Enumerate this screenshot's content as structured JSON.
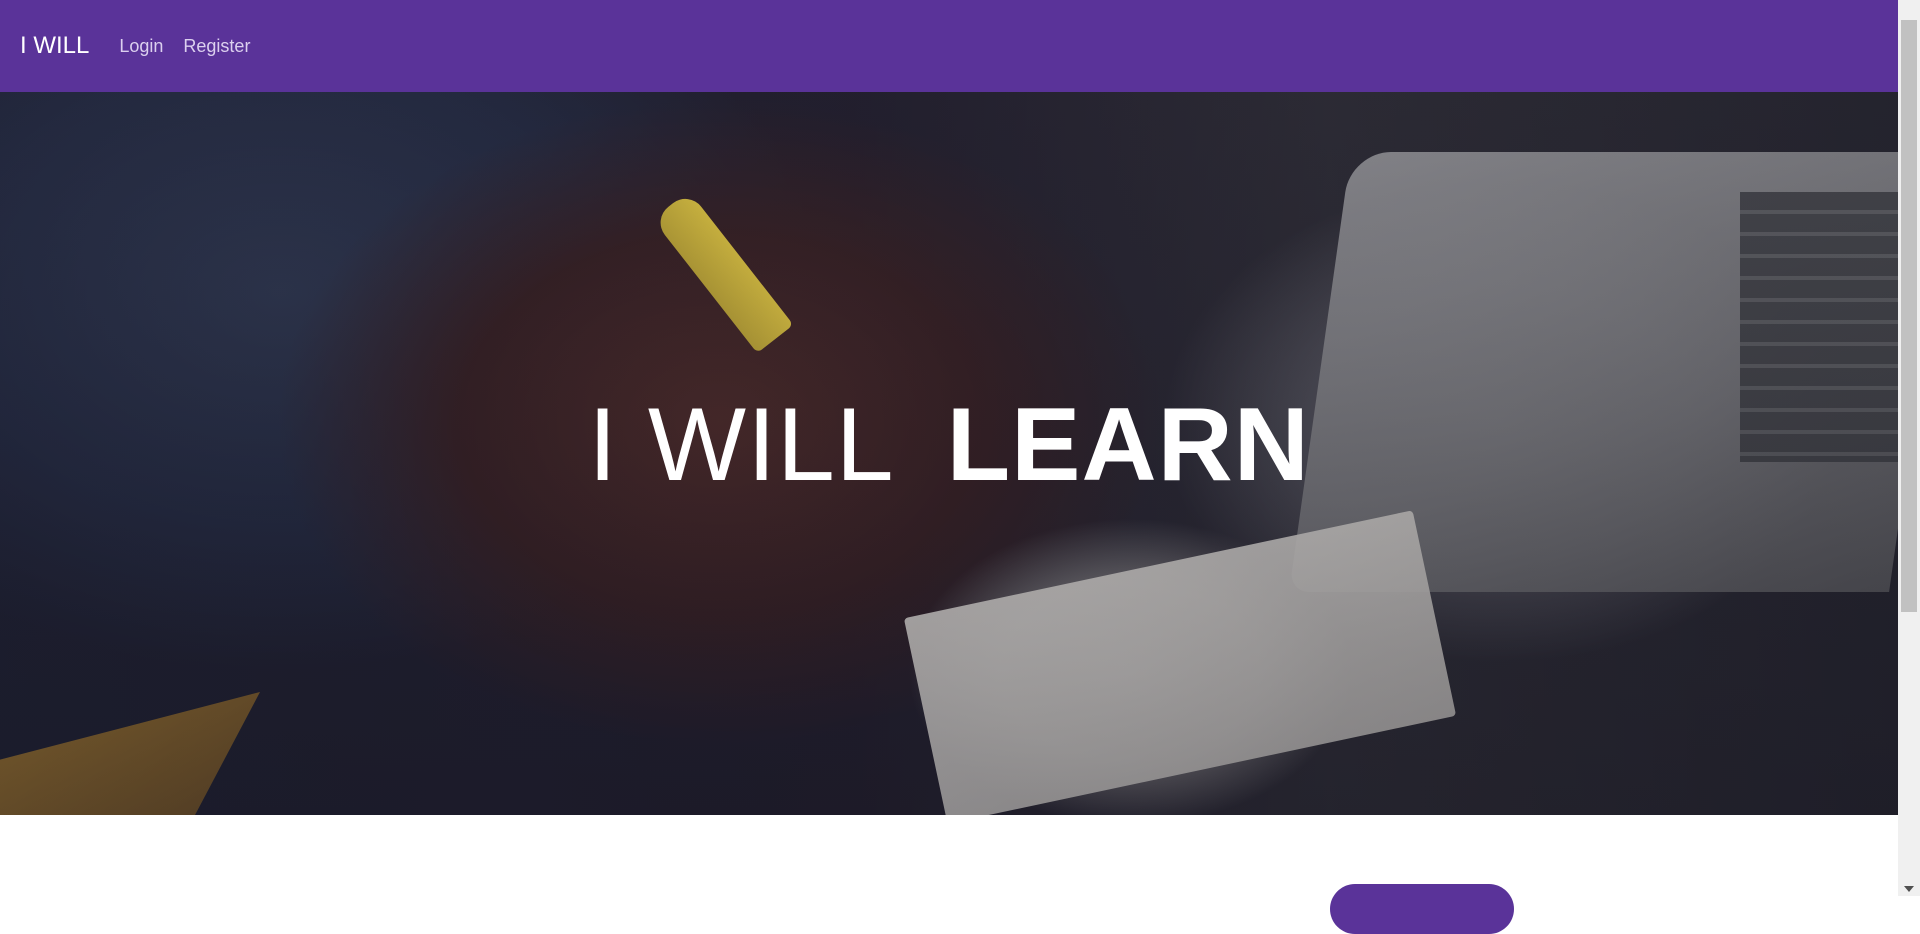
{
  "navbar": {
    "brand": "I WILL",
    "links": [
      {
        "label": "Login"
      },
      {
        "label": "Register"
      }
    ],
    "background_color": "#5a3399"
  },
  "hero": {
    "title_light": "I WILL",
    "title_bold": "LEARN",
    "background_description_icon": "desk-writing-photo"
  }
}
